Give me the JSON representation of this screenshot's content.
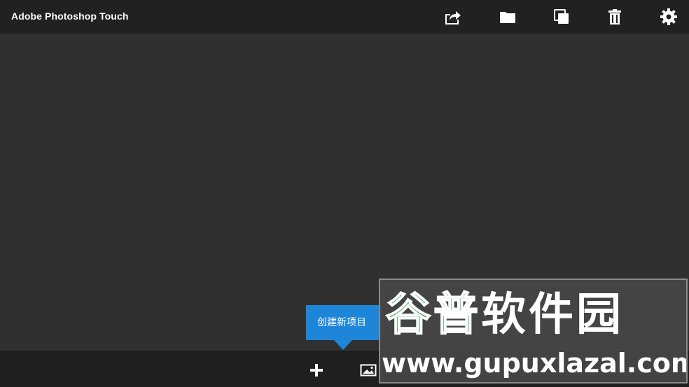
{
  "app": {
    "title": "Adobe Photoshop Touch"
  },
  "toolbar": {
    "icons": [
      "share-icon",
      "folder-icon",
      "duplicate-icon",
      "delete-icon",
      "settings-icon"
    ]
  },
  "bottombar": {
    "icons": [
      "plus-icon",
      "image-icon"
    ]
  },
  "tooltip": {
    "text": "创建新项目"
  },
  "watermark": {
    "chinese_part1": "谷普",
    "chinese_part2": "软件园",
    "url": "www.gupuxlazal.com"
  },
  "colors": {
    "topbar": "#212121",
    "background": "#303030",
    "bottombar": "#1f1f1f",
    "accent": "#1e86d9",
    "watermark_green": "#2fa14a"
  }
}
